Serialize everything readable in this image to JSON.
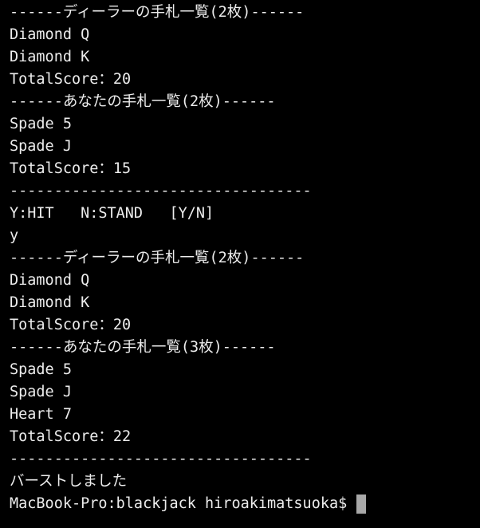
{
  "terminal": {
    "lines": [
      "------ディーラーの手札一覧(2枚)------",
      "Diamond Q",
      "Diamond K",
      "TotalScore：20",
      "------あなたの手札一覧(2枚)------",
      "Spade 5",
      "Spade J",
      "TotalScore：15",
      "----------------------------------",
      "Y:HIT   N:STAND   [Y/N]",
      "y",
      "------ディーラーの手札一覧(2枚)------",
      "Diamond Q",
      "Diamond K",
      "TotalScore：20",
      "------あなたの手札一覧(3枚)------",
      "Spade 5",
      "Spade J",
      "Heart 7",
      "TotalScore：22",
      "----------------------------------",
      "バーストしました"
    ],
    "prompt": "MacBook-Pro:blackjack hiroakimatsuoka$"
  }
}
